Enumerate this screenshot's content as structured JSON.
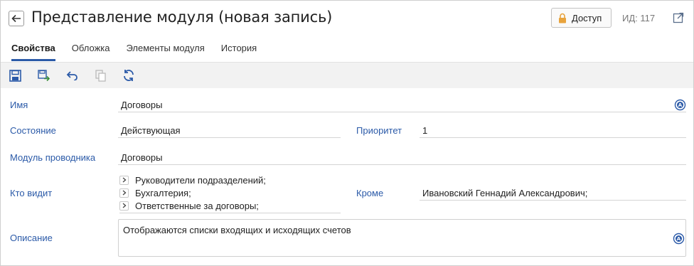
{
  "header": {
    "title": "Представление модуля (новая запись)",
    "access_label": "Доступ",
    "id_label": "ИД: 117"
  },
  "tabs": [
    {
      "label": "Свойства",
      "active": true
    },
    {
      "label": "Обложка",
      "active": false
    },
    {
      "label": "Элементы модуля",
      "active": false
    },
    {
      "label": "История",
      "active": false
    }
  ],
  "toolbar": {
    "items": [
      "save-icon",
      "save-and-close-icon",
      "undo-icon",
      "copy-icon",
      "refresh-icon"
    ]
  },
  "form": {
    "name": {
      "label": "Имя",
      "value": "Договоры"
    },
    "state": {
      "label": "Состояние",
      "value": "Действующая"
    },
    "priority": {
      "label": "Приоритет",
      "value": "1"
    },
    "explorer_module": {
      "label": "Модуль проводника",
      "value": "Договоры"
    },
    "who_sees": {
      "label": "Кто видит",
      "items": [
        "Руководители подразделений;",
        "Бухгалтерия;",
        "Ответственные за договоры;"
      ]
    },
    "except": {
      "label": "Кроме",
      "value": "Ивановский Геннадий Александрович;"
    },
    "description": {
      "label": "Описание",
      "value": "Отображаются списки входящих и исходящих счетов"
    }
  },
  "colors": {
    "accent": "#2b5aa8",
    "label": "#2b5aa8",
    "lock": "#e8a33c",
    "disabled": "#b9b9b9"
  }
}
